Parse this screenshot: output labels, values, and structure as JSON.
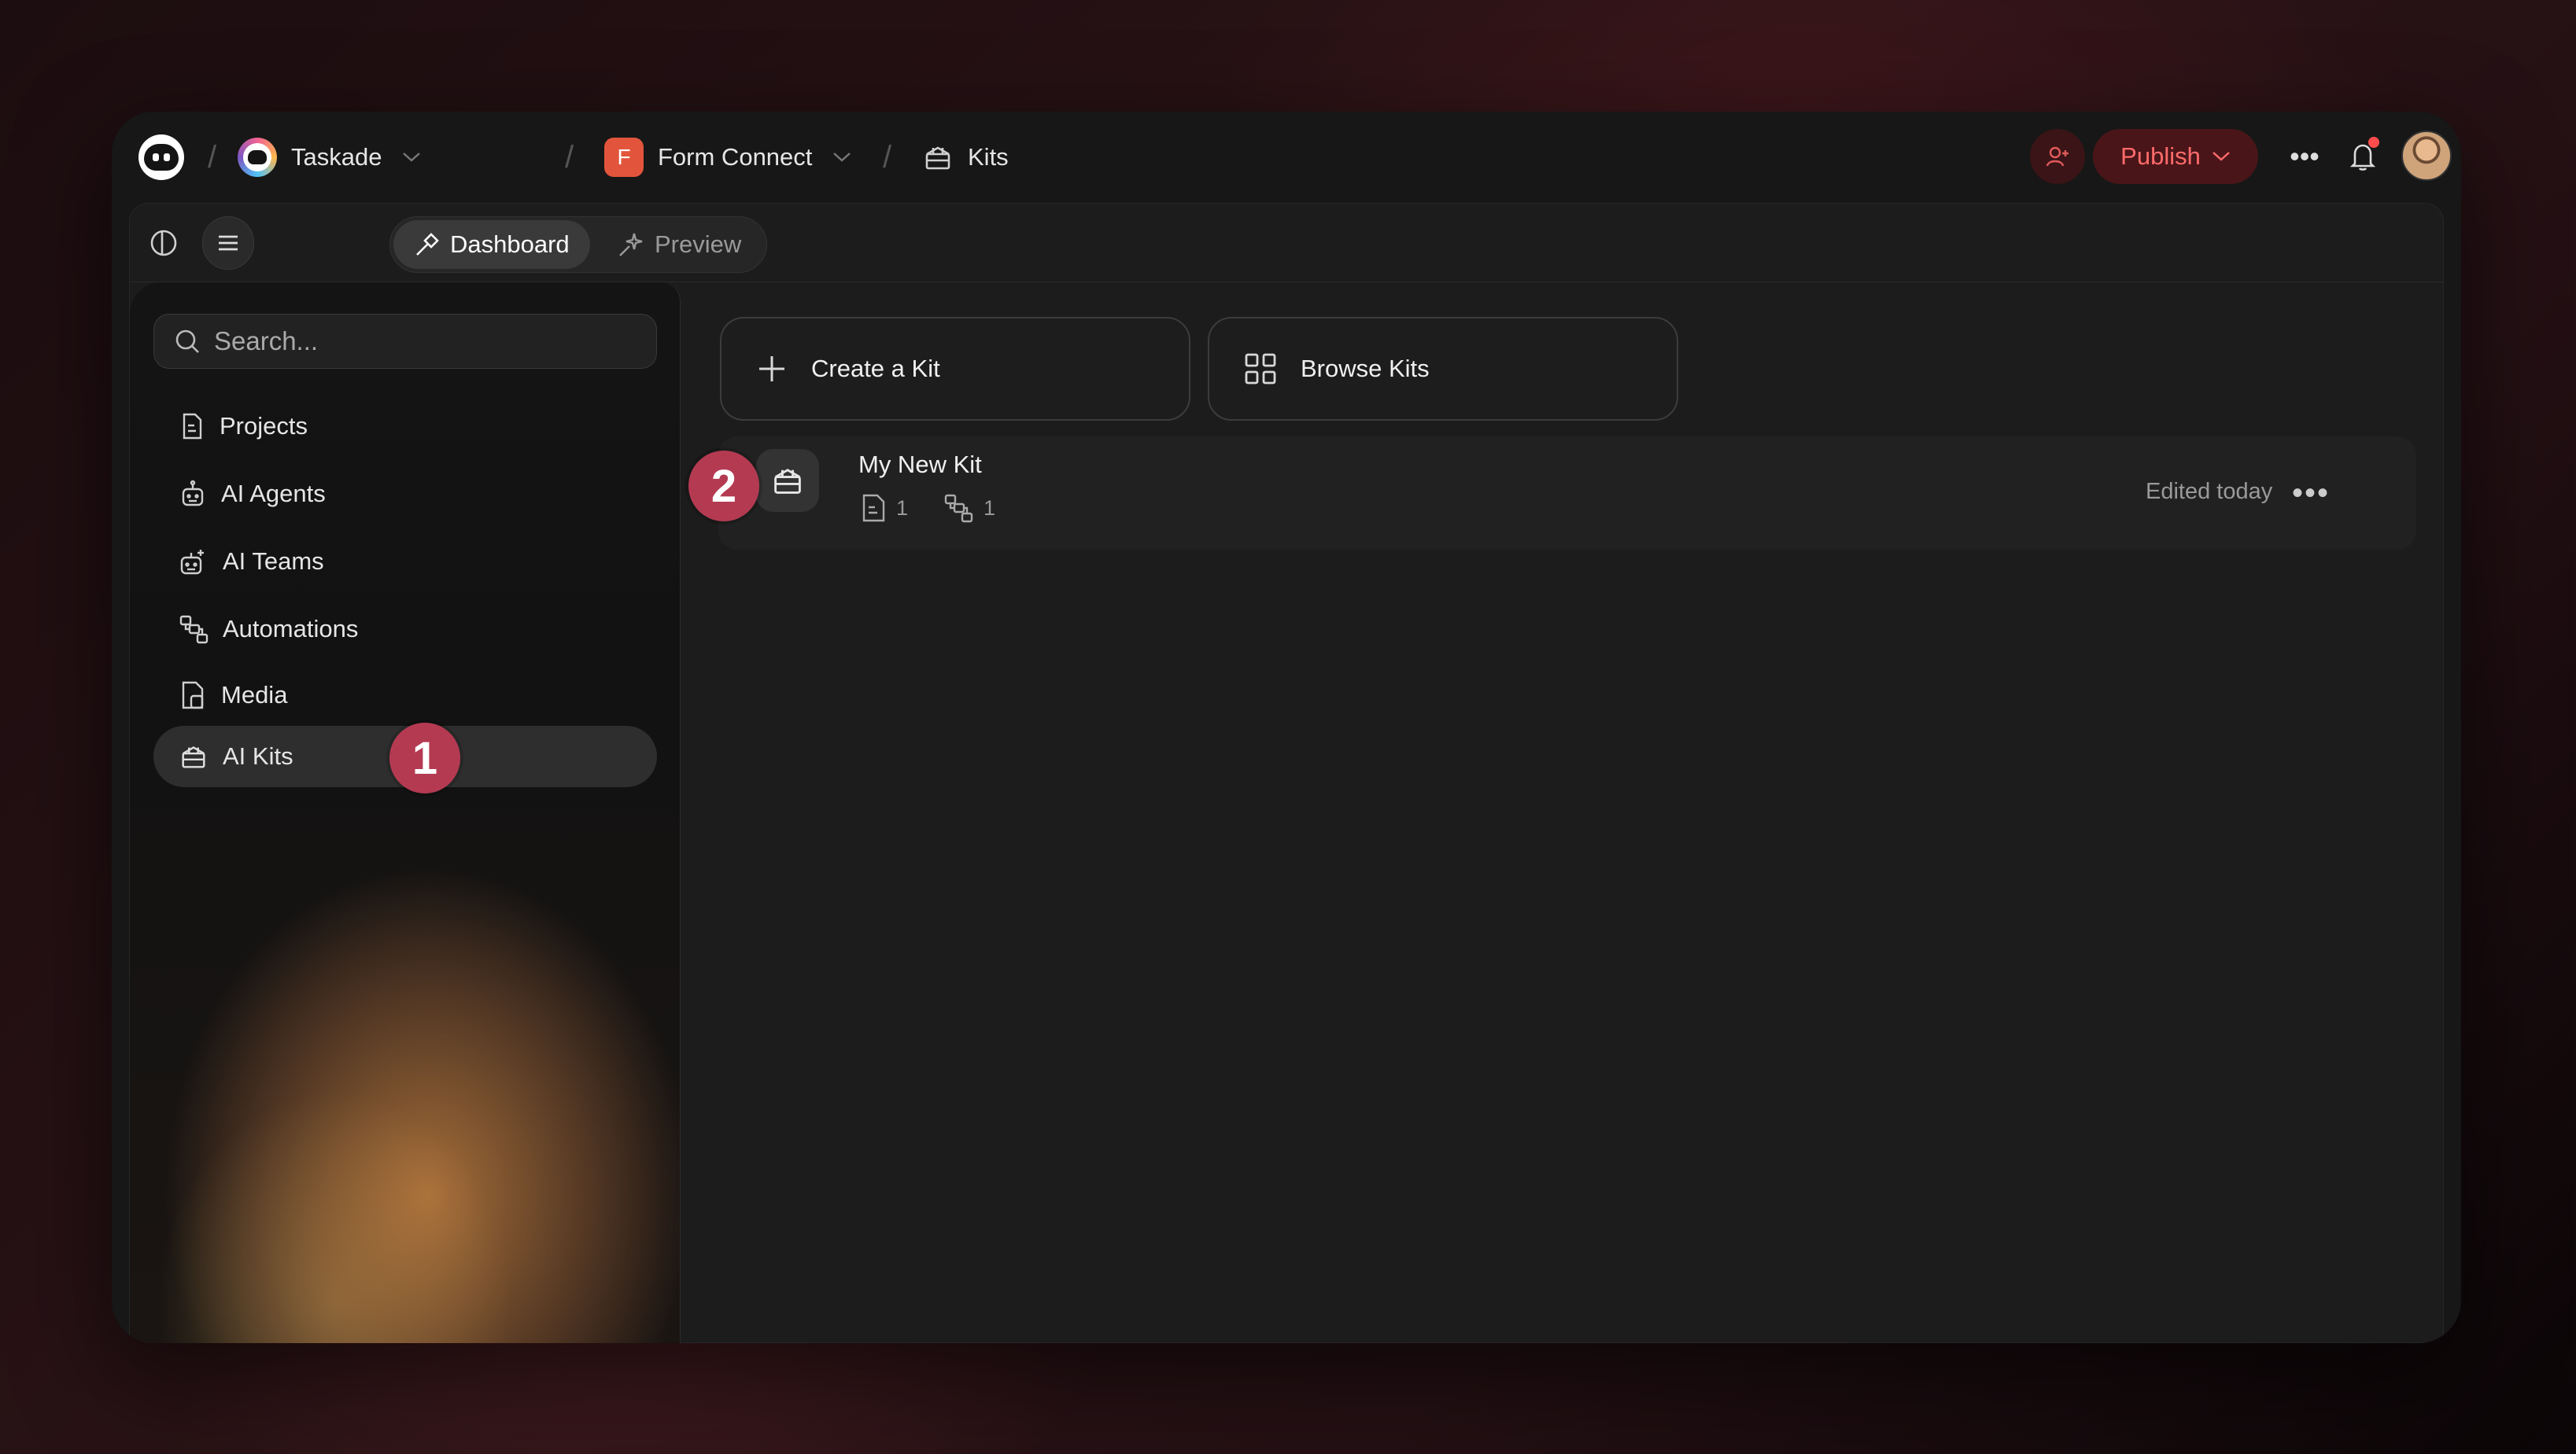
{
  "topbar": {
    "workspace_name": "Taskade",
    "project_initial": "F",
    "project_name": "Form Connect",
    "current_page": "Kits",
    "publish_label": "Publish",
    "more_glyph": "•••",
    "notification_dot_color": "#ff4d4d"
  },
  "toolbar": {
    "tabs": [
      {
        "label": "Dashboard",
        "icon": "hammer-icon",
        "active": true
      },
      {
        "label": "Preview",
        "icon": "sparkle-icon",
        "active": false
      }
    ]
  },
  "sidebar": {
    "search_placeholder": "Search...",
    "items": [
      {
        "label": "Projects",
        "icon": "document-icon"
      },
      {
        "label": "AI Agents",
        "icon": "robot-icon"
      },
      {
        "label": "AI Teams",
        "icon": "team-robot-icon"
      },
      {
        "label": "Automations",
        "icon": "workflow-icon"
      },
      {
        "label": "Media",
        "icon": "media-file-icon"
      },
      {
        "label": "AI Kits",
        "icon": "kit-box-icon",
        "active": true
      }
    ]
  },
  "main": {
    "create_kit_label": "Create a Kit",
    "browse_kits_label": "Browse Kits",
    "kits": [
      {
        "name": "My New Kit",
        "project_count": "1",
        "automation_count": "1",
        "edited": "Edited today",
        "more_glyph": "•••"
      }
    ]
  },
  "annotations": {
    "step_1": "1",
    "step_2": "2",
    "badge_color": "#b43a52"
  },
  "colors": {
    "accent_publish": "#ff6b6b",
    "publish_bg": "#4a1518"
  }
}
